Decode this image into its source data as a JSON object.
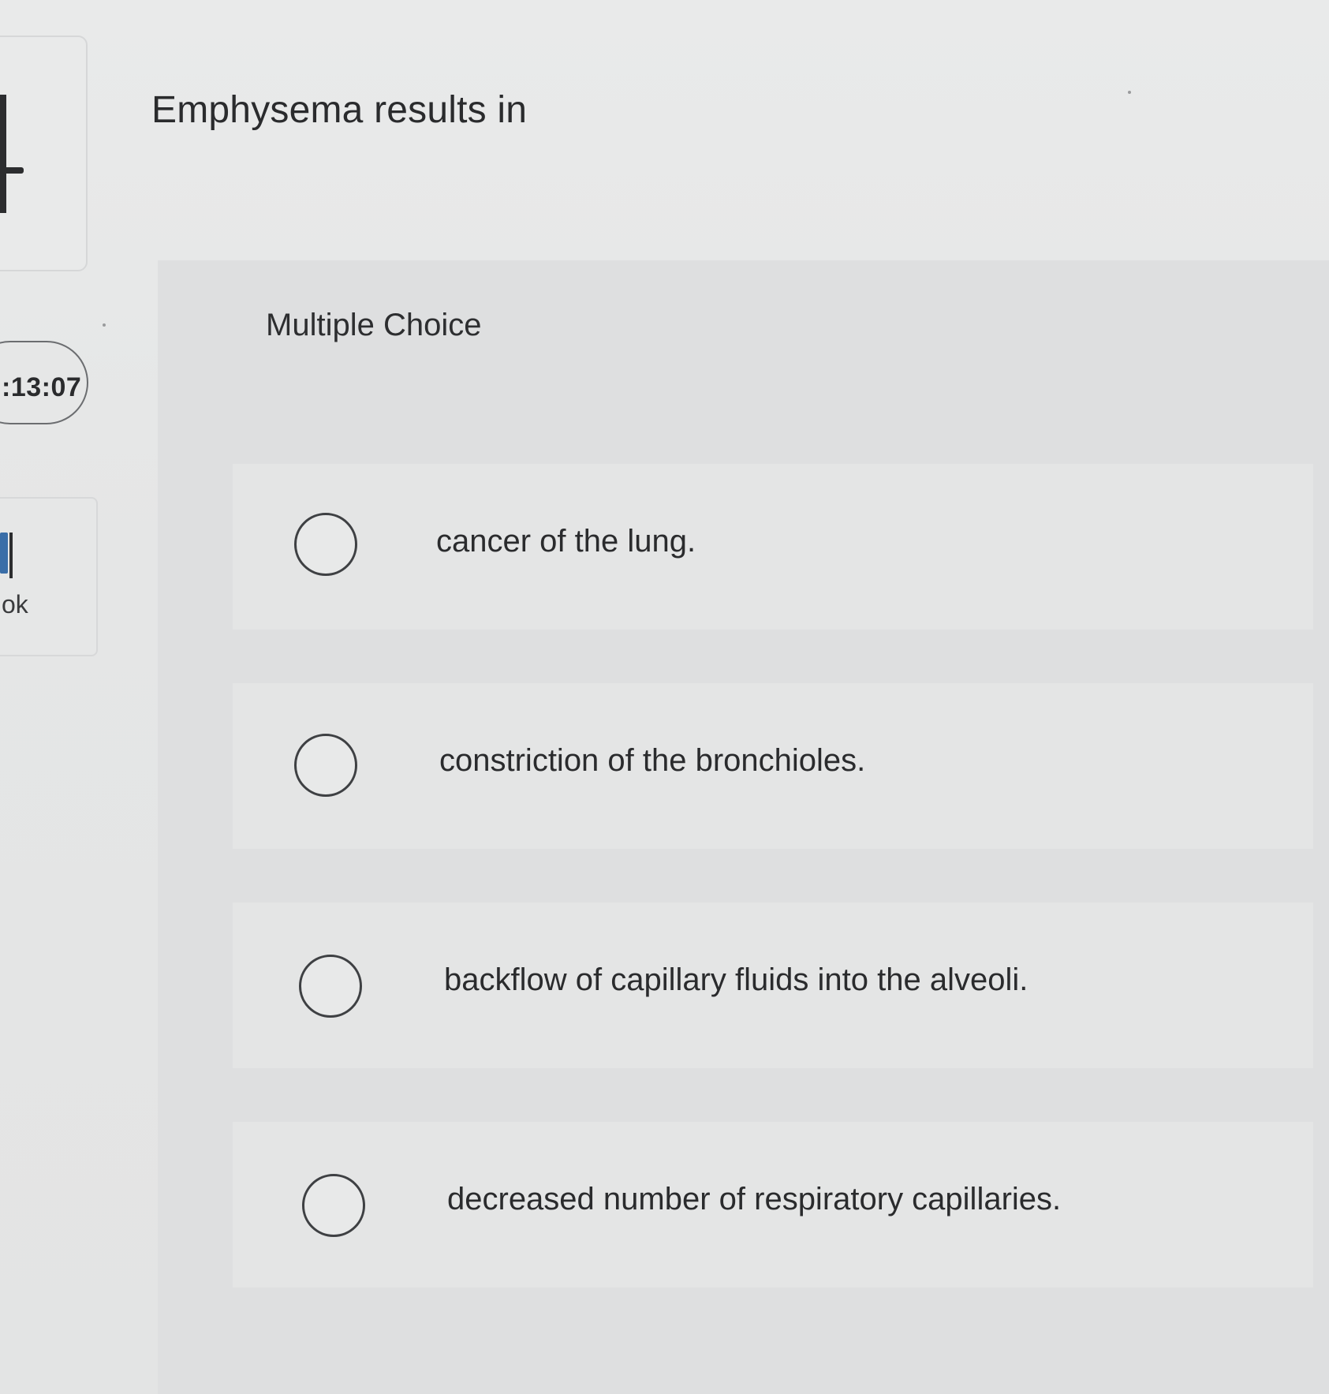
{
  "timer": {
    "time": ":13:07"
  },
  "ebook": {
    "label": "ok"
  },
  "question": {
    "text": "Emphysema results in"
  },
  "answer_panel": {
    "type_label": "Multiple Choice",
    "options": [
      {
        "text": "cancer of the lung."
      },
      {
        "text": "constriction of the bronchioles."
      },
      {
        "text": "backflow of capillary fluids into the alveoli."
      },
      {
        "text": "decreased number of respiratory capillaries."
      }
    ]
  },
  "icons": [
    "timer-pill",
    "ebook-icon",
    "radio-unselected-icon"
  ]
}
